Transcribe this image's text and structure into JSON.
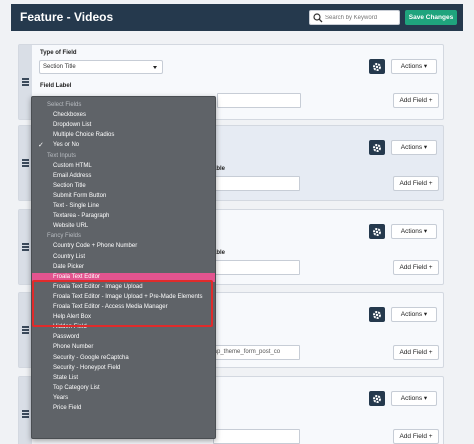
{
  "header": {
    "title": "Feature - Videos",
    "search_placeholder": "Search by Keyword",
    "save_label": "Save Changes"
  },
  "card1": {
    "type_label": "Type of Field",
    "type_value": "Section Title",
    "field_label_label": "Field Label",
    "actions_label": "Actions",
    "add_field_label": "Add Field +"
  },
  "cards_common": {
    "actions_label": "Actions",
    "add_field_label": "Add Field +"
  },
  "card5": {
    "text_fragment": "strap_theme_form_post_co"
  },
  "fragments": {
    "able": "able"
  },
  "dropdown": {
    "items": [
      {
        "label": "Select Fields",
        "kind": "group"
      },
      {
        "label": "Checkboxes",
        "kind": "item"
      },
      {
        "label": "Dropdown List",
        "kind": "item"
      },
      {
        "label": "Multiple Choice Radios",
        "kind": "item"
      },
      {
        "label": "Yes or No",
        "kind": "item",
        "checked": true
      },
      {
        "label": "Text Inputs",
        "kind": "group"
      },
      {
        "label": "Custom HTML",
        "kind": "item"
      },
      {
        "label": "Email Address",
        "kind": "item"
      },
      {
        "label": "Section Title",
        "kind": "item"
      },
      {
        "label": "Submit Form Button",
        "kind": "item"
      },
      {
        "label": "Text - Single Line",
        "kind": "item"
      },
      {
        "label": "Textarea - Paragraph",
        "kind": "item"
      },
      {
        "label": "Website URL",
        "kind": "item"
      },
      {
        "label": "Fancy Fields",
        "kind": "group"
      },
      {
        "label": "Country Code + Phone Number",
        "kind": "item"
      },
      {
        "label": "Country List",
        "kind": "item"
      },
      {
        "label": "Date Picker",
        "kind": "item"
      },
      {
        "label": "Froala Text Editor",
        "kind": "item",
        "active": true
      },
      {
        "label": "Froala Text Editor - Image Upload",
        "kind": "item"
      },
      {
        "label": "Froala Text Editor - Image Upload + Pre-Made Elements",
        "kind": "item"
      },
      {
        "label": "Froala Text Editor - Access Media Manager",
        "kind": "item"
      },
      {
        "label": "Help Alert Box",
        "kind": "item"
      },
      {
        "label": "Hidden Field",
        "kind": "item"
      },
      {
        "label": "Password",
        "kind": "item"
      },
      {
        "label": "Phone Number",
        "kind": "item"
      },
      {
        "label": "Security - Google reCaptcha",
        "kind": "item"
      },
      {
        "label": "Security - Honeypot Field",
        "kind": "item"
      },
      {
        "label": "State List",
        "kind": "item"
      },
      {
        "label": "Top Category List",
        "kind": "item"
      },
      {
        "label": "Years",
        "kind": "item"
      },
      {
        "label": "Price Field",
        "kind": "item"
      }
    ]
  },
  "colors": {
    "header_bg": "#25394d",
    "save_btn": "#1fa47d",
    "dropdown_bg": "#5f6368",
    "active_item": "#e3548f",
    "highlight_border": "#e02b2b"
  }
}
